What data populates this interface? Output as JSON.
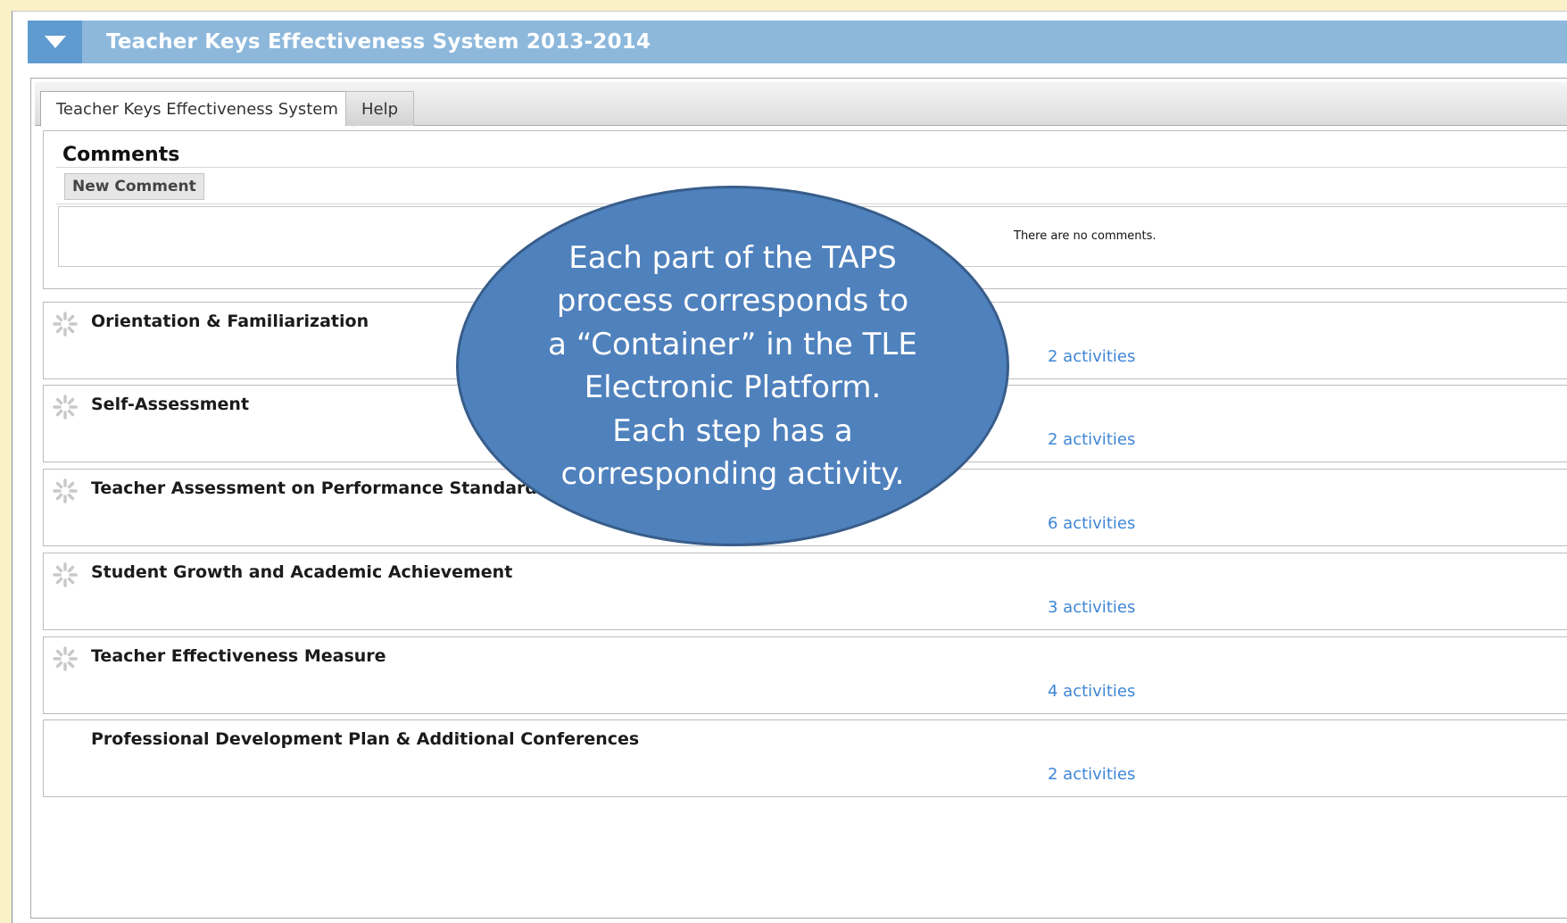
{
  "header": {
    "title": "Teacher Keys Effectiveness System 2013-2014"
  },
  "tabs": [
    {
      "label": "Teacher Keys Effectiveness System"
    },
    {
      "label": "Help"
    }
  ],
  "comments": {
    "title": "Comments",
    "new_label": "New Comment",
    "empty_text": "There are no comments."
  },
  "containers": [
    {
      "name": "Orientation & Familiarization",
      "activities": "2 activities",
      "icon": "spinner-icon"
    },
    {
      "name": "Self-Assessment",
      "activities": "2 activities",
      "icon": "spinner-icon"
    },
    {
      "name": "Teacher Assessment on Performance Standards",
      "activities": "6 activities",
      "icon": "spinner-icon"
    },
    {
      "name": "Student Growth and Academic Achievement",
      "activities": "3 activities",
      "icon": "spinner-icon"
    },
    {
      "name": "Teacher Effectiveness Measure",
      "activities": "4 activities",
      "icon": "spinner-icon"
    },
    {
      "name": "Professional Development Plan & Additional Conferences",
      "activities": "2 activities"
    }
  ],
  "callout": {
    "lines": [
      "Each part of the TAPS",
      "process corresponds to",
      "a “Container” in the TLE",
      "Electronic Platform.",
      "Each step has a",
      "corresponding activity."
    ]
  },
  "colors": {
    "titlebar": "#8db8dc",
    "callout": "#4f81bd",
    "link": "#3f86d6",
    "background": "#fbf1c8"
  }
}
